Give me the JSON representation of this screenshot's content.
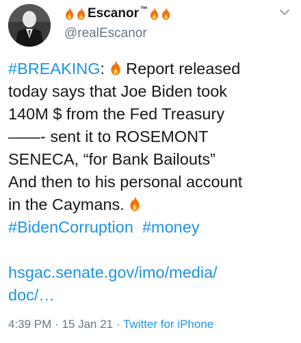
{
  "tweet": {
    "display_name": "Escanor",
    "trademark": "™",
    "handle": "@realEscanor",
    "body_lines": {
      "l1_tag": "#BREAKING",
      "l1_colon": ":",
      "l1_text": "Report released",
      "l2": "today says that Joe Biden took",
      "l3": "140M $ from the Fed Treasury",
      "l4": "——- sent it to ROSEMONT",
      "l5": "SENECA, “for Bank Bailouts”",
      "l6": "And then to his personal account",
      "l7": "in the Caymans.",
      "tag1": "#BidenCorruption",
      "tag2": "#money",
      "link1": "hsgac.senate.gov/imo/media/",
      "link2": "doc/…"
    },
    "time": "4:39 PM",
    "date": "15 Jan 21",
    "separator": "·",
    "source": "Twitter for iPhone"
  },
  "icons": {
    "flame": "fire-emoji",
    "menu": "chevron-down"
  },
  "colors": {
    "link": "#1b95e0",
    "text": "#14171a",
    "muted": "#657786",
    "flame_outer": "#f4700c",
    "flame_inner": "#ffcc4d"
  }
}
